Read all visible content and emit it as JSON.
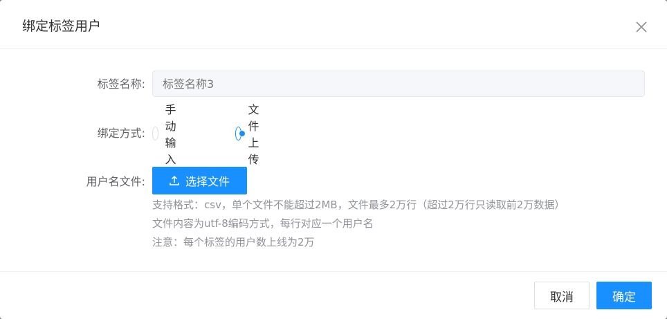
{
  "dialog": {
    "title": "绑定标签用户"
  },
  "form": {
    "tag_name_label": "标签名称:",
    "tag_name_placeholder": "标签名称3",
    "bind_mode_label": "绑定方式:",
    "bind_modes": [
      {
        "label": "手动输入",
        "checked": false
      },
      {
        "label": "文件上传",
        "checked": true
      }
    ],
    "file_label": "用户名文件:",
    "upload_button_label": "选择文件",
    "hints": [
      "支持格式：csv，单个文件不能超过2MB，文件最多2万行（超过2万行只读取前2万数据）",
      "文件内容为utf-8编码方式，每行对应一个用户名",
      "注意：每个标签的用户数上线为2万"
    ]
  },
  "footer": {
    "cancel_label": "取消",
    "confirm_label": "确定"
  },
  "colors": {
    "primary": "#1890ff",
    "hint_text": "#909399",
    "label_text": "#606266"
  }
}
